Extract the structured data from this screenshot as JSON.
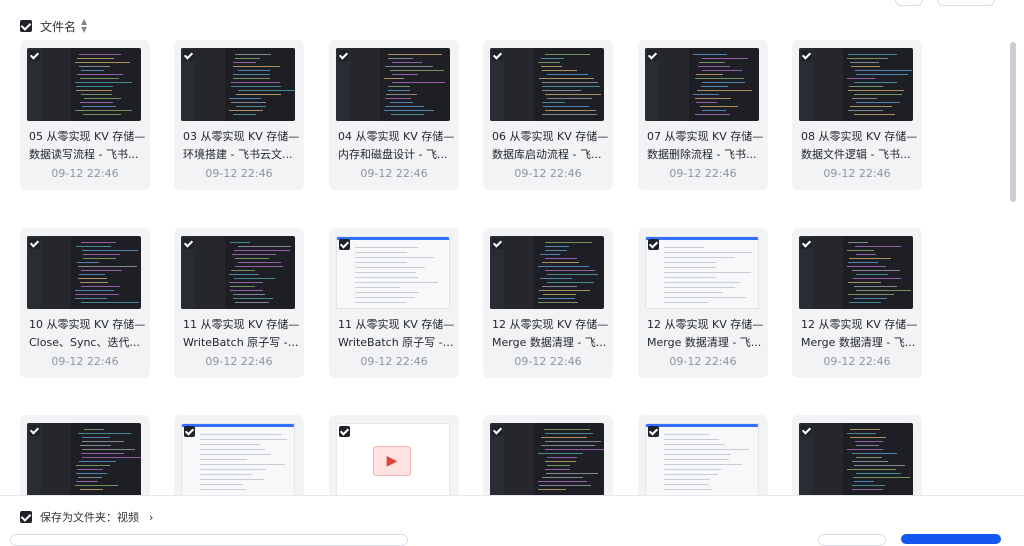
{
  "header": {
    "column_label": "文件名"
  },
  "files": [
    {
      "line1": "05 从零实现 KV 存储—",
      "line2": "数据读写流程 - 飞书...",
      "date": "09-12 22:46",
      "thumb": "dark"
    },
    {
      "line1": "03 从零实现 KV 存储—",
      "line2": "环境搭建 - 飞书云文...",
      "date": "09-12 22:46",
      "thumb": "dark"
    },
    {
      "line1": "04 从零实现 KV 存储—",
      "line2": "内存和磁盘设计 - 飞...",
      "date": "09-12 22:46",
      "thumb": "dark"
    },
    {
      "line1": "06 从零实现 KV 存储—",
      "line2": "数据库启动流程 - 飞...",
      "date": "09-12 22:46",
      "thumb": "dark"
    },
    {
      "line1": "07 从零实现 KV 存储—",
      "line2": "数据删除流程 - 飞书...",
      "date": "09-12 22:46",
      "thumb": "dark"
    },
    {
      "line1": "08 从零实现 KV 存储—",
      "line2": "数据文件逻辑 - 飞书...",
      "date": "09-12 22:46",
      "thumb": "dark"
    },
    {
      "line1": "10 从零实现 KV 存储—",
      "line2": "Close、Sync、迭代...",
      "date": "09-12 22:46",
      "thumb": "dark"
    },
    {
      "line1": "11 从零实现 KV 存储—",
      "line2": "WriteBatch 原子写 - ...",
      "date": "09-12 22:46",
      "thumb": "dark"
    },
    {
      "line1": "11 从零实现 KV 存储—",
      "line2": "WriteBatch 原子写 - ...",
      "date": "09-12 22:46",
      "thumb": "light"
    },
    {
      "line1": "12 从零实现 KV 存储—",
      "line2": "Merge 数据清理 - 飞...",
      "date": "09-12 22:46",
      "thumb": "dark"
    },
    {
      "line1": "12 从零实现 KV 存储—",
      "line2": "Merge 数据清理 - 飞...",
      "date": "09-12 22:46",
      "thumb": "light"
    },
    {
      "line1": "12 从零实现 KV 存储—",
      "line2": "Merge 数据清理 - 飞...",
      "date": "09-12 22:46",
      "thumb": "dark"
    },
    {
      "line1": "",
      "line2": "",
      "date": "",
      "thumb": "dark"
    },
    {
      "line1": "",
      "line2": "",
      "date": "",
      "thumb": "light"
    },
    {
      "line1": "",
      "line2": "",
      "date": "",
      "thumb": "video"
    },
    {
      "line1": "",
      "line2": "",
      "date": "",
      "thumb": "dark"
    },
    {
      "line1": "",
      "line2": "",
      "date": "",
      "thumb": "light"
    },
    {
      "line1": "",
      "line2": "",
      "date": "",
      "thumb": "dark"
    }
  ],
  "footer": {
    "save_label": "保存为文件夹：视频",
    "chevron": "›"
  },
  "colors": {
    "accent": "#1456f0",
    "card_bg": "#f2f3f5",
    "dark_thumb": "#1e1f24"
  },
  "icons": {
    "video": "play-icon"
  }
}
